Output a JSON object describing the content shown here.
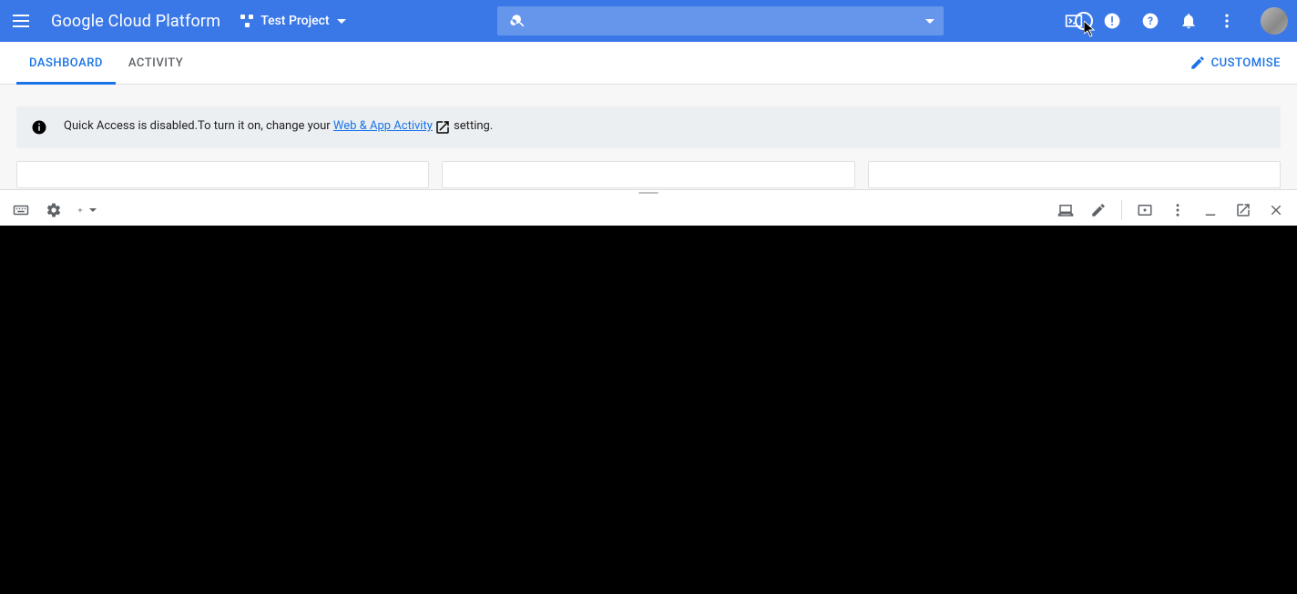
{
  "header": {
    "logo_text": "Google Cloud Platform",
    "project_name": "Test Project",
    "search_placeholder": ""
  },
  "tabs": {
    "items": [
      "DASHBOARD",
      "ACTIVITY"
    ],
    "active_index": 0,
    "customise_label": "CUSTOMISE"
  },
  "banner": {
    "text_prefix": "Quick Access is disabled.To turn it on, change your ",
    "link_text": "Web & App Activity",
    "text_suffix": "  setting."
  }
}
